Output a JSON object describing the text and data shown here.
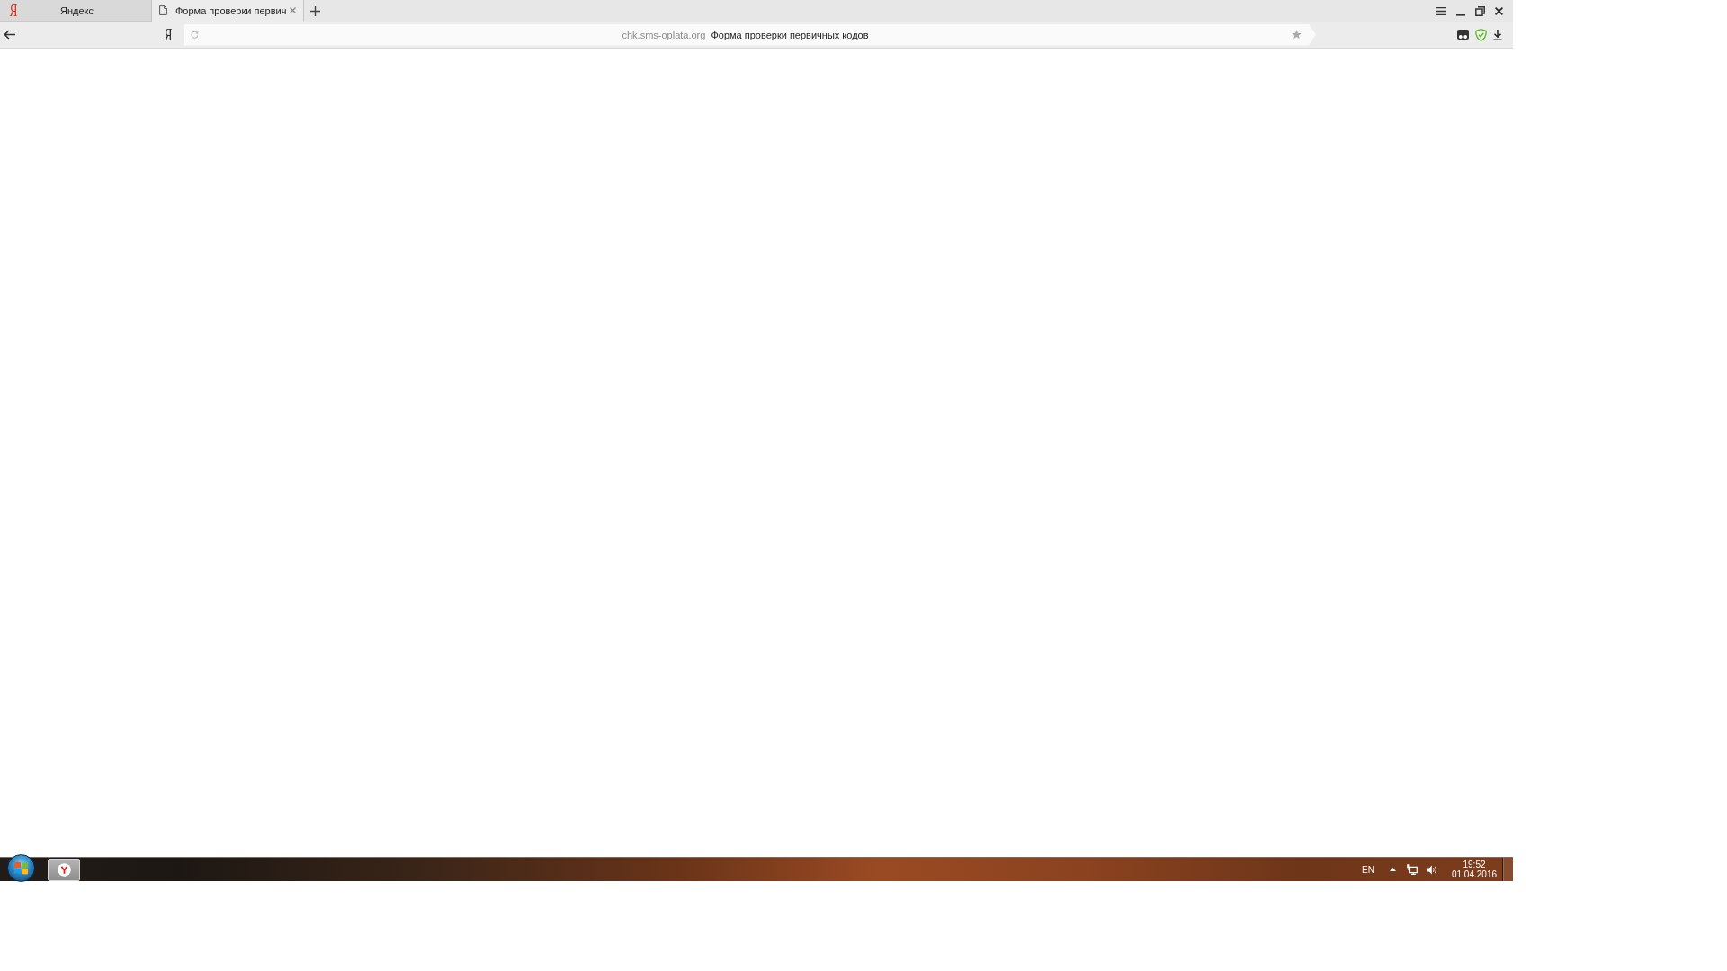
{
  "browser": {
    "tabs": [
      {
        "kind": "logo",
        "logo": "Я",
        "title": "Яндекс",
        "selected": false
      },
      {
        "kind": "document",
        "title": "Форма проверки первич",
        "selected": true
      }
    ],
    "toolbar": {
      "logo": "Я",
      "address": {
        "domain": "chk.sms-oplata.org",
        "page_title": "Форма проверки первичных кодов"
      }
    }
  },
  "taskbar": {
    "tray": {
      "language": "EN",
      "time": "19:52",
      "date": "01.04.2016"
    }
  }
}
